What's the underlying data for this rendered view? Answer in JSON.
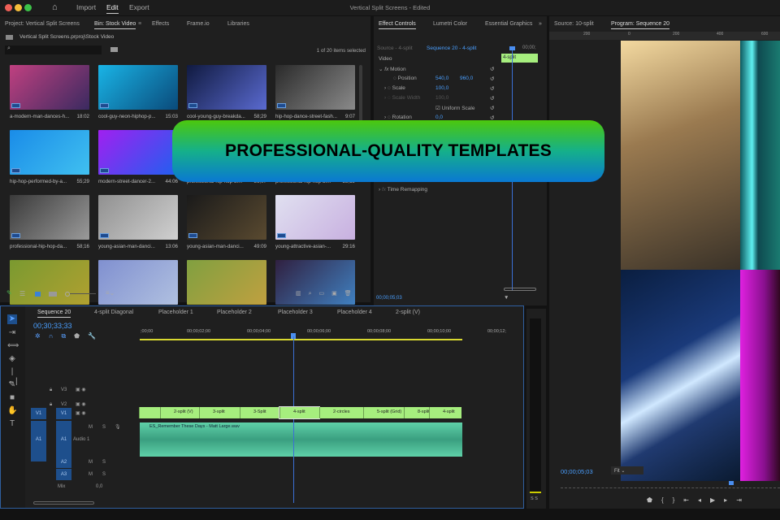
{
  "titlebar": {
    "workspaces": [
      "Import",
      "Edit",
      "Export"
    ],
    "active": "Edit",
    "title": "Vertical Split Screens - Edited"
  },
  "project": {
    "tabs": [
      "Project: Vertical Split Screens",
      "Bin: Stock Video",
      "Effects",
      "Frame.io",
      "Libraries"
    ],
    "path": "Vertical Split Screens.prproj\\Stock Video",
    "search_placeholder": "",
    "selection": "1 of 20 items selected",
    "items": [
      {
        "name": "a-modern-man-dances-h...",
        "dur": "18:02",
        "c1": "#c04080",
        "c2": "#3a2a60"
      },
      {
        "name": "cool-guy-neon-hiphop-p...",
        "dur": "15:03",
        "c1": "#19b4e6",
        "c2": "#0a4a7a"
      },
      {
        "name": "cool-young-guy-breakda...",
        "dur": "58;29",
        "c1": "#101a40",
        "c2": "#5a6ad0"
      },
      {
        "name": "hip-hop-dance-street-fash...",
        "dur": "9:07",
        "c1": "#2a2a2a",
        "c2": "#8a8a8a"
      },
      {
        "name": "hip-hop-performed-by-a...",
        "dur": "55;29",
        "c1": "#1a8ce8",
        "c2": "#40c0f0"
      },
      {
        "name": "modern-street-dancer-2...",
        "dur": "44:06",
        "c1": "#a020f0",
        "c2": "#2060f0"
      },
      {
        "name": "professional-hip-hop-br...",
        "dur": "56;07",
        "c1": "#303060",
        "c2": "#606090"
      },
      {
        "name": "professional-hip-hop-br...",
        "dur": "58;19",
        "c1": "#404040",
        "c2": "#707070"
      },
      {
        "name": "professional-hip-hop-da...",
        "dur": "58;16",
        "c1": "#3a3a3a",
        "c2": "#9a9a9a"
      },
      {
        "name": "young-asian-man-danci...",
        "dur": "13:06",
        "c1": "#909090",
        "c2": "#d0d0d0"
      },
      {
        "name": "young-asian-man-danci...",
        "dur": "49:09",
        "c1": "#1a1a1a",
        "c2": "#5a4a30"
      },
      {
        "name": "young-attractive-asian-...",
        "dur": "29:16",
        "c1": "#e0e0f0",
        "c2": "#c8b0e0"
      },
      {
        "name": "",
        "dur": "",
        "c1": "#7a9a30",
        "c2": "#b0a030"
      },
      {
        "name": "",
        "dur": "",
        "c1": "#8090d0",
        "c2": "#b0c0e0"
      },
      {
        "name": "",
        "dur": "",
        "c1": "#80a040",
        "c2": "#c0a040"
      },
      {
        "name": "",
        "dur": "",
        "c1": "#302040",
        "c2": "#4080c0"
      }
    ]
  },
  "effects": {
    "tabs": [
      "Effect Controls",
      "Lumetri Color",
      "Essential Graphics"
    ],
    "source": "Source - 4-split",
    "sequence": "Sequence 20 - 4-split",
    "timecode_head": "00;00;",
    "clip": "4-split",
    "section": "Video",
    "motion": "Motion",
    "rows": [
      {
        "label": "Position",
        "v1": "540,0",
        "v2": "960,0"
      },
      {
        "label": "Scale",
        "v1": "100,0",
        "v2": ""
      },
      {
        "label": "Scale Width",
        "v1": "100,0",
        "v2": ""
      },
      {
        "label": "Rotation",
        "v1": "0,0",
        "v2": ""
      }
    ],
    "uniform": "Uniform Scale",
    "time_remap": "Time Remapping",
    "timecode": "00;00;05;03"
  },
  "program": {
    "tabs": [
      "Source: 10-split",
      "Program: Sequence 20"
    ],
    "ruler": [
      "200",
      "0",
      "200",
      "400",
      "600"
    ],
    "timecode": "00;00;05;03",
    "fit": "Fit"
  },
  "banner": {
    "text": "PROFESSIONAL-QUALITY TEMPLATES"
  },
  "timeline": {
    "tabs": [
      "Sequence 20",
      "4-split Diagonal",
      "Placeholder 1",
      "Placeholder 2",
      "Placeholder 3",
      "Placeholder 4",
      "2-split (V)"
    ],
    "timecode": "00;30;33;33",
    "ruler": [
      ";00;00",
      "00;00;02;00",
      "00;00;04;00",
      "00;00;06;00",
      "00;00;08;00",
      "00;00;10;00",
      "00;00;12;"
    ],
    "tracks": {
      "v3": "V3",
      "v2": "V2",
      "v1": "V1",
      "a1": "A1",
      "a2": "A2",
      "a3": "A3",
      "audio1": "Audio 1",
      "mix": "Mix",
      "mix_val": "0,0",
      "m": "M",
      "s": "S"
    },
    "clips": [
      "",
      "2-split (V)",
      "3-split",
      "3-Split",
      "4-split",
      "2-circles",
      "5-split (Grid)",
      "8-split",
      "4-split"
    ],
    "audio_clip": "ES_Remember These Days - Matt Large.wav",
    "meter": "S S"
  }
}
